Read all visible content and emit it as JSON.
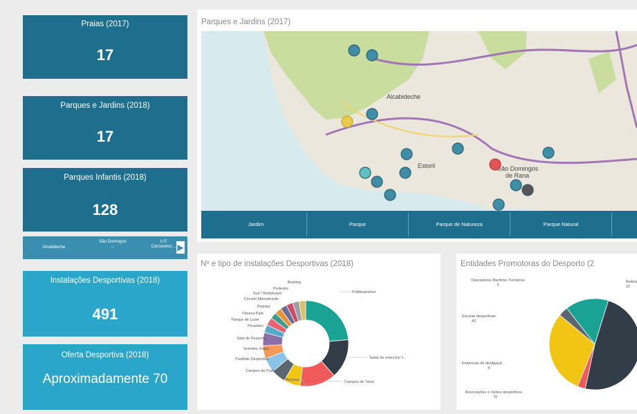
{
  "cards": [
    {
      "title": "Praias (2017)",
      "value": "17",
      "color": "#1e6f8e"
    },
    {
      "title": "Parques e Jardins (2018)",
      "value": "17",
      "color": "#1e6f8e"
    },
    {
      "title": "Parques Infantis (2018)",
      "value": "128",
      "color": "#1e6f8e"
    },
    {
      "title": "Instalações  Desportivas (2018)",
      "value": "491",
      "color": "#2ba6cb"
    },
    {
      "title": "Oferta Desportiva (2018)",
      "value": "Aproximadamente 70",
      "color": "#2ba6cb"
    }
  ],
  "slicer": {
    "items": [
      "Alcabideche",
      "São Domingos ...",
      "U.F. Carcavelos ..."
    ]
  },
  "map": {
    "title": "Parques e Jardins (2017)",
    "places": [
      "Alcabideche",
      "Estoril",
      "São Domingos de Rana"
    ],
    "tabs": [
      "Jardim",
      "Parque",
      "Parque de Natureza",
      "Parque Natural"
    ]
  },
  "chart1": {
    "title": "Nº e tipo  de instalações  Desportivas (2018)"
  },
  "chart2": {
    "title": "Entidades Promotoras do Desporto (2"
  },
  "chart_data": [
    {
      "type": "pie",
      "title": "Nº e tipo  de instalações  Desportivas (2018)",
      "donut": true,
      "categories": [
        "Polidesportivo",
        "Salas de exercício f...",
        "Campos de Ténis",
        "Piscinas",
        "Campos de Padel",
        "Pavilhão Desportivo",
        "Grandes Jogos",
        "Sala de Desporto",
        "Picadeiro",
        "Parque de Lazer",
        "Fitness Park",
        "Pistolas",
        "Circuito Manutenção",
        "Surf / Bodyboard",
        "Pedestre",
        "Bowling"
      ],
      "values": [
        95,
        60,
        55,
        25,
        22,
        22,
        20,
        20,
        12,
        12,
        10,
        10,
        10,
        10,
        10,
        10
      ],
      "colors": [
        "#1aa295",
        "#333d47",
        "#f05a5a",
        "#f2c414",
        "#5b6670",
        "#89c4e8",
        "#f39a5a",
        "#8a6fa8",
        "#57a7cb",
        "#e8636f",
        "#3f9b8c",
        "#e8923a",
        "#6b6b9a",
        "#c94f68",
        "#a0a0a0",
        "#d9c26a"
      ]
    },
    {
      "type": "pie",
      "title": "Entidades Promotoras do Desporto (2",
      "categories": [
        "Associações e clubes desportivos",
        "Empresas de divulgaçã...",
        "Escolas desportivas",
        "Operadores Marítimo-Turísticos",
        "Autarquia"
      ],
      "values": [
        70,
        4,
        43,
        5,
        22
      ],
      "colors": [
        "#333d47",
        "#f05a5a",
        "#f2c414",
        "#5b6670",
        "#1aa295"
      ]
    }
  ],
  "chart_labels": {
    "c1": [
      "Bowling",
      "Pedestre",
      "Surf / Bodyboard",
      "Circuito Manutenção",
      "Pistolas",
      "Fitness Park",
      "Parque de Lazer",
      "Picadeiro",
      "Sala de Desporto",
      "Grandes Jogos",
      "Pavilhão Desportivo",
      "Campos de Padel",
      "Piscinas",
      "Campos de Ténis",
      "Salas de exercício f...",
      "Polidesportivo"
    ],
    "c2": {
      "op": "Operadores Marítimo-Turísticos",
      "op_v": "5",
      "esc": "Escolas desportivas",
      "esc_v": "43",
      "emp": "Empresas de divulgaçã...",
      "emp_v": "4",
      "assoc": "Associações e clubes desportivos",
      "assoc_v": "70",
      "aut": "Autarq",
      "aut_v": "22"
    }
  }
}
